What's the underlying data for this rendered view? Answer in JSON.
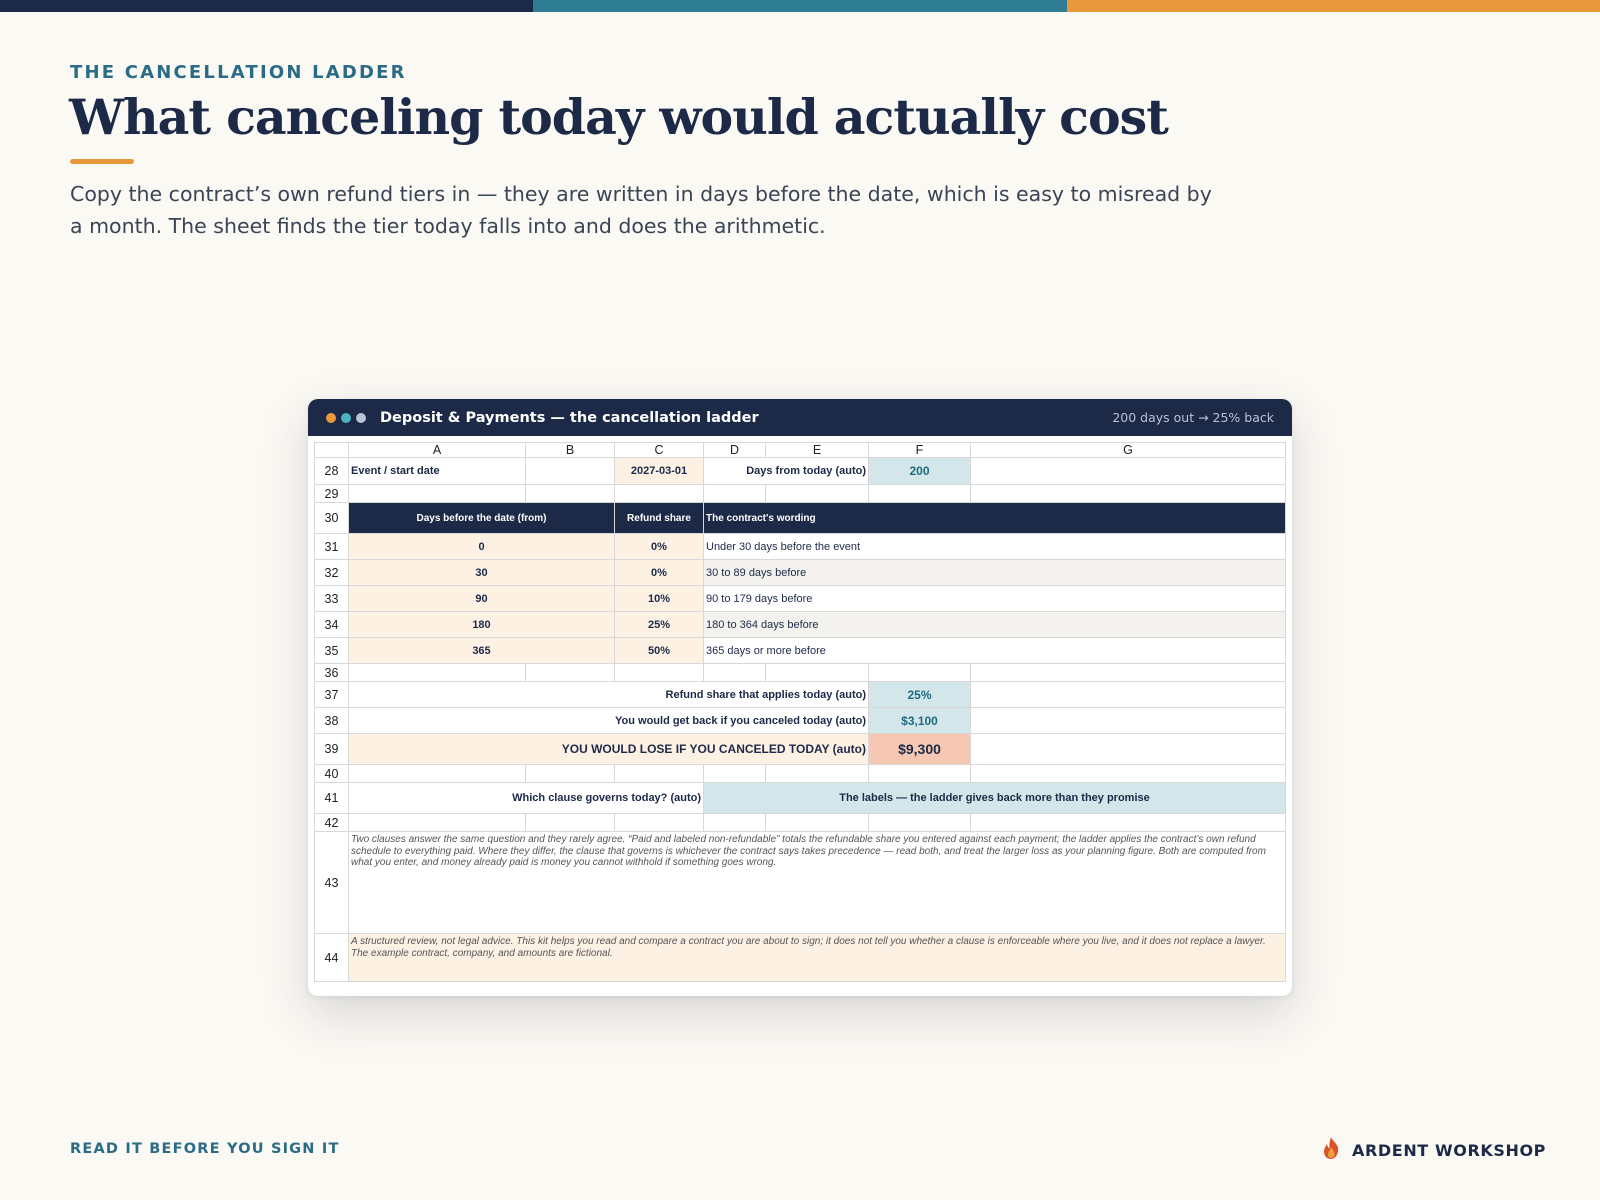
{
  "colors": {
    "navy": "#1c2a48",
    "teal": "#2e7d92",
    "orange": "#e9993c",
    "peach": "#fdf1e4",
    "teal_fill": "#d3e7ea",
    "loss_fill": "#f6c8b4"
  },
  "eyebrow": "THE CANCELLATION LADDER",
  "title": "What canceling today would actually cost",
  "lede": "Copy the contract’s own refund tiers in — they are written in days before the date, which is easy to misread by a month. The sheet finds the tier today falls into and does the arithmetic.",
  "window": {
    "title": "Deposit & Payments — the cancellation ladder",
    "status": "200 days out → 25% back",
    "dot_colors": [
      "#e9993c",
      "#4fb3c0",
      "#b9c2d4"
    ]
  },
  "sheet": {
    "columns": [
      "A",
      "B",
      "C",
      "D",
      "E",
      "F",
      "G"
    ],
    "row_numbers": [
      "28",
      "29",
      "30",
      "31",
      "32",
      "33",
      "34",
      "35",
      "36",
      "37",
      "38",
      "39",
      "40",
      "41",
      "42",
      "43",
      "44"
    ],
    "row28": {
      "label": "Event / start date",
      "date": "2027-03-01",
      "days_label": "Days from today (auto)",
      "days_value": "200"
    },
    "header": {
      "days": "Days before the date (from)",
      "share": "Refund share",
      "wording": "The contract's wording"
    },
    "tiers": [
      {
        "days": "0",
        "share": "0%",
        "wording": "Under 30 days before the event"
      },
      {
        "days": "30",
        "share": "0%",
        "wording": "30 to 89 days before"
      },
      {
        "days": "90",
        "share": "10%",
        "wording": "90 to 179 days before"
      },
      {
        "days": "180",
        "share": "25%",
        "wording": "180 to 364 days before"
      },
      {
        "days": "365",
        "share": "50%",
        "wording": "365 days or more before"
      }
    ],
    "refund_share": {
      "label": "Refund share that applies today (auto)",
      "value": "25%"
    },
    "get_back": {
      "label": "You would get back if you canceled today (auto)",
      "value": "$3,100"
    },
    "lose": {
      "label": "YOU WOULD LOSE IF YOU CANCELED TODAY (auto)",
      "value": "$9,300"
    },
    "clause": {
      "label": "Which clause governs today? (auto)",
      "value": "The labels — the ladder gives back more than they promise"
    },
    "note43": "Two clauses answer the same question and they rarely agree. “Paid and labeled non-refundable” totals the refundable share you entered against each payment; the ladder applies the contract’s own refund schedule to everything paid. Where they differ, the clause that governs is whichever the contract says takes precedence — read both, and treat the larger loss as your planning figure. Both are computed from what you enter, and money already paid is money you cannot withhold if something goes wrong.",
    "note44": "A structured review, not legal advice. This kit helps you read and compare a contract you are about to sign; it does not tell you whether a clause is enforceable where you live, and it does not replace a lawyer. The example contract, company, and amounts are fictional."
  },
  "footer": {
    "tagline": "READ IT BEFORE YOU SIGN IT",
    "brand": "ARDENT WORKSHOP",
    "logo_icon": "flame-icon"
  }
}
